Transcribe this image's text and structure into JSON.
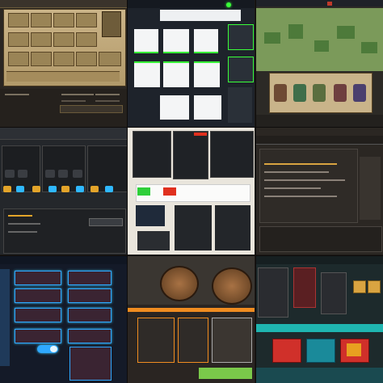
{
  "collage": {
    "tile_count": 9,
    "top_left": {
      "theme": "parchment-inventory",
      "accent": "#b89a5a",
      "tabs": [
        "",
        "",
        "",
        "",
        ""
      ],
      "item_slots": 15,
      "status_rows": 3
    },
    "top_middle": {
      "theme": "card-dashboard",
      "accent": "#39ff39",
      "card_count": 9
    },
    "top_right": {
      "theme": "map-roster",
      "accent": "#c03a2a",
      "character_count": 5
    },
    "middle_left": {
      "theme": "dark-character-slots",
      "accent": "#2fb8ff",
      "slots_per_row": 5,
      "rows": 2
    },
    "center": {
      "theme": "dual-dark-panels",
      "accent": "#e0301e",
      "toggle_colors": [
        "#2fcf3a",
        "#e0301e"
      ]
    },
    "middle_right": {
      "theme": "terminal-settings",
      "accent": "#d9a441"
    },
    "bottom_left": {
      "theme": "neon-blue-menu",
      "accent": "#2fa8ff",
      "menu_rows": 5
    },
    "bottom_middle": {
      "theme": "cookie-shop",
      "accent": "#f08c20"
    },
    "bottom_right": {
      "theme": "teal-shop",
      "accent": "#1fb5b0",
      "card_colors": [
        "#d0302a",
        "#1a8a9a",
        "#d0302a"
      ]
    }
  }
}
